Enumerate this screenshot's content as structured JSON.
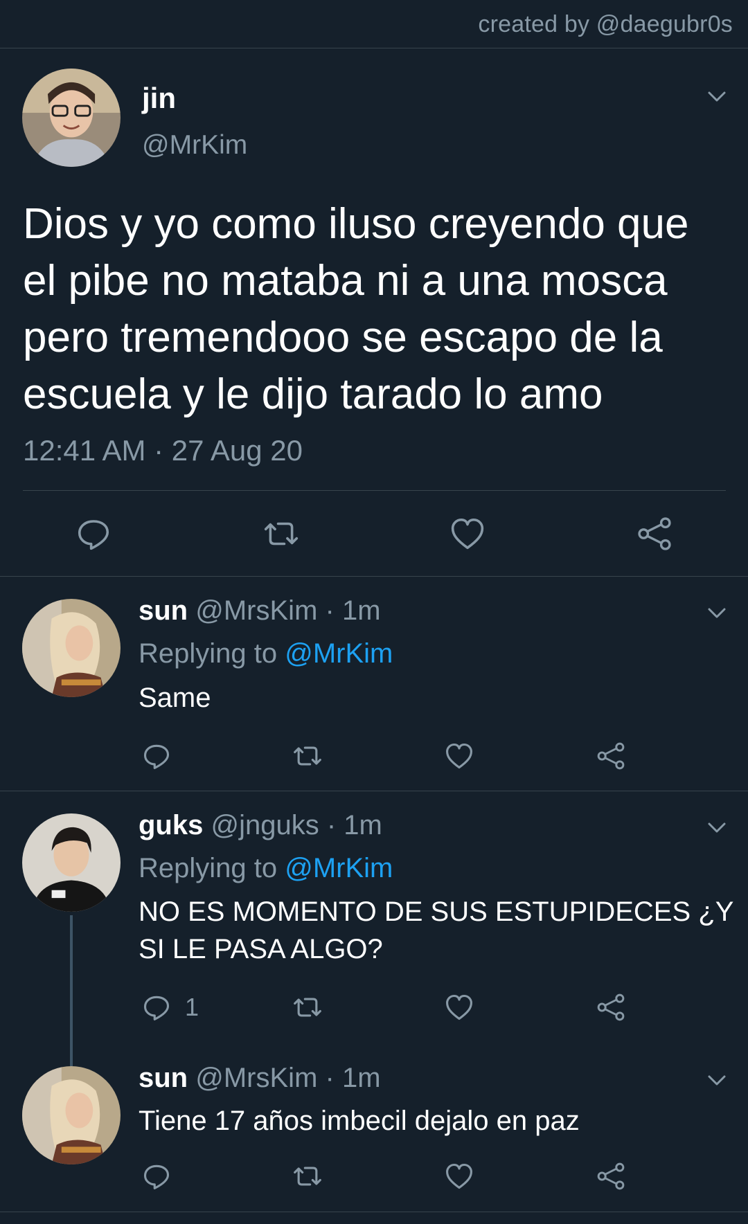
{
  "credit": "created by @daegubr0s",
  "main_tweet": {
    "name": "jin",
    "handle": "@MrKim",
    "text": "Dios y yo como iluso creyendo que el pibe no mataba ni a una mosca pero tremendooo se escapo de la escuela y le dijo tarado lo amo",
    "timestamp": "12:41 AM · 27 Aug 20",
    "avatar_icon": "jin-avatar"
  },
  "replies": [
    {
      "name": "sun",
      "handle": "@MrsKim",
      "sep": "·",
      "time": "1m",
      "replying_prefix": "Replying to ",
      "replying_to": "@MrKim",
      "text": "Same",
      "reply_count": ""
    },
    {
      "name": "guks",
      "handle": "@jnguks",
      "sep": "·",
      "time": "1m",
      "replying_prefix": "Replying to ",
      "replying_to": "@MrKim",
      "text": "NO ES MOMENTO DE SUS ESTUPIDECES ¿Y SI LE PASA ALGO?",
      "reply_count": "1"
    },
    {
      "name": "sun",
      "handle": "@MrsKim",
      "sep": "·",
      "time": "1m",
      "text": "Tiene 17 años imbecil dejalo en paz",
      "reply_count": ""
    }
  ],
  "colors": {
    "background": "#15202b",
    "secondary_text": "#8899a6",
    "link": "#1da1f2",
    "divider": "#38444d"
  }
}
